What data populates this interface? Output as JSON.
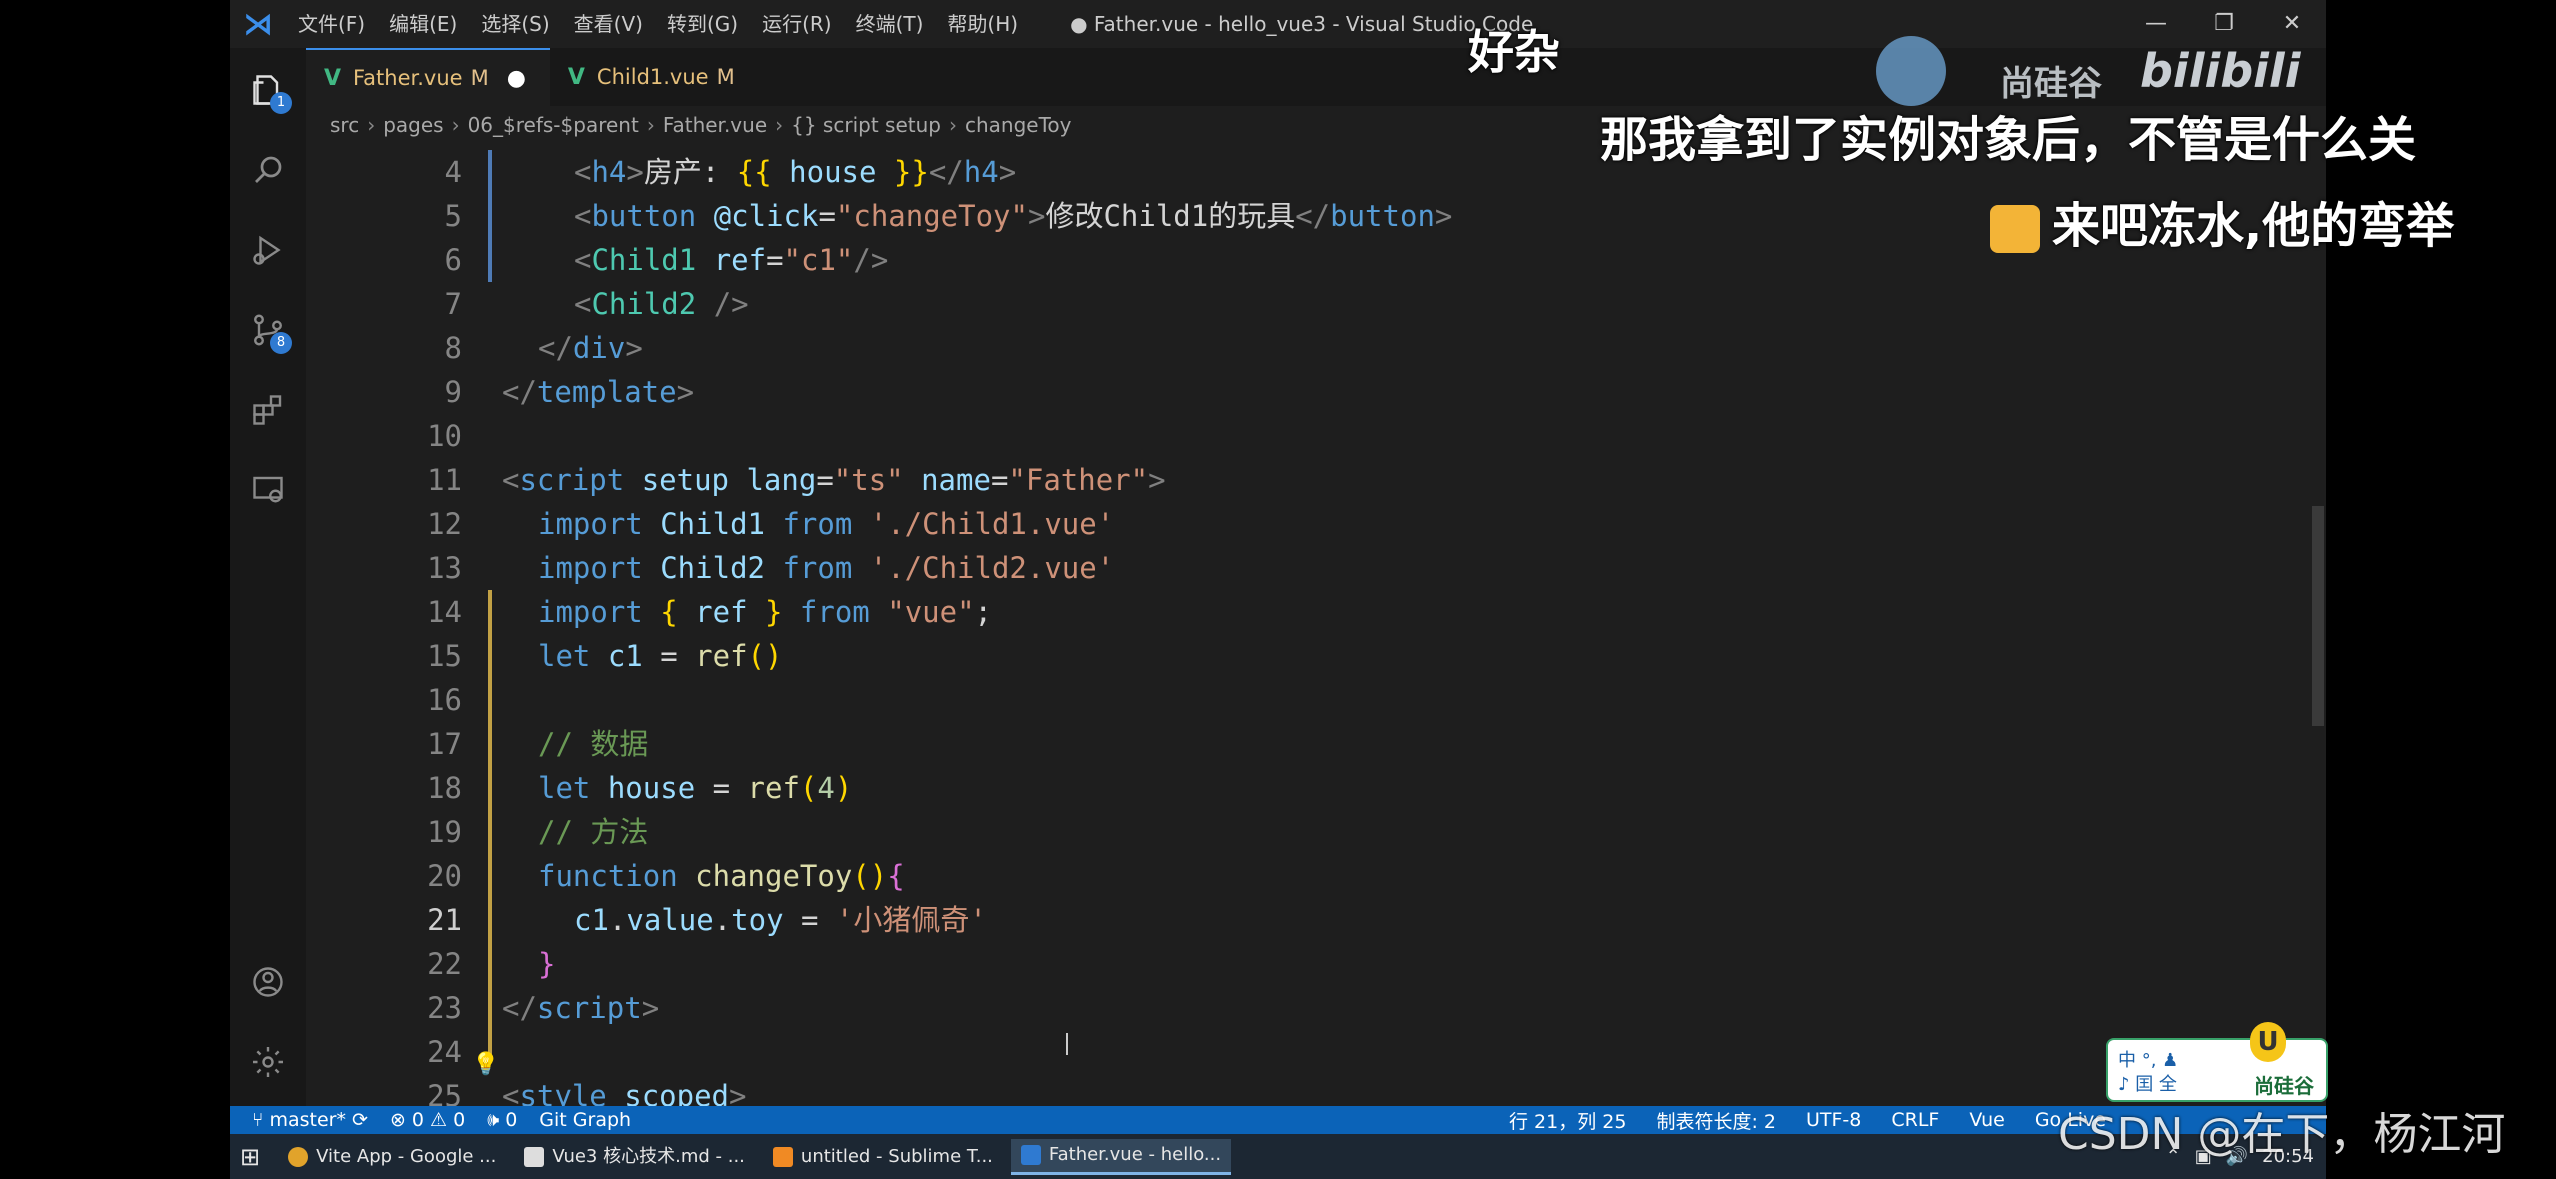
{
  "titlebar": {
    "menus": [
      "文件(F)",
      "编辑(E)",
      "选择(S)",
      "查看(V)",
      "转到(G)",
      "运行(R)",
      "终端(T)",
      "帮助(H)"
    ],
    "title": "● Father.vue - hello_vue3 - Visual Studio Code"
  },
  "activity_badges": {
    "explorer": "1",
    "source_control": "8"
  },
  "tabs": [
    {
      "name": "Father.vue",
      "status": "M",
      "dirty": "●"
    },
    {
      "name": "Child1.vue",
      "status": "M"
    }
  ],
  "breadcrumb": [
    "src",
    "pages",
    "06_$refs-$parent",
    "Father.vue",
    "{} script setup",
    "changeToy"
  ],
  "current_line": 21,
  "lines": [
    {
      "n": "4",
      "tokens": [
        [
          "punc",
          "<"
        ],
        [
          "tag",
          "h4"
        ],
        [
          "punc",
          ">"
        ],
        [
          "plain",
          "房产: "
        ],
        [
          "br",
          "{{"
        ],
        [
          "var",
          " house "
        ],
        [
          "br",
          "}}"
        ],
        [
          "punc",
          "</"
        ],
        [
          "tag",
          "h4"
        ],
        [
          "punc",
          ">"
        ]
      ],
      "indent": 2
    },
    {
      "n": "5",
      "tokens": [
        [
          "punc",
          "<"
        ],
        [
          "tag",
          "button"
        ],
        [
          "attr",
          " @click"
        ],
        [
          "plain",
          "="
        ],
        [
          "str",
          "\"changeToy\""
        ],
        [
          "punc",
          ">"
        ],
        [
          "plain",
          "修改Child1的玩具"
        ],
        [
          "punc",
          "</"
        ],
        [
          "tag",
          "button"
        ],
        [
          "punc",
          ">"
        ]
      ],
      "indent": 2
    },
    {
      "n": "6",
      "tokens": [
        [
          "punc",
          "<"
        ],
        [
          "cls",
          "Child1"
        ],
        [
          "attr",
          " ref"
        ],
        [
          "plain",
          "="
        ],
        [
          "str",
          "\"c1\""
        ],
        [
          "punc",
          "/>"
        ]
      ],
      "indent": 2
    },
    {
      "n": "7",
      "tokens": [
        [
          "punc",
          "<"
        ],
        [
          "cls",
          "Child2"
        ],
        [
          "punc",
          " />"
        ]
      ],
      "indent": 2
    },
    {
      "n": "8",
      "tokens": [
        [
          "punc",
          "</"
        ],
        [
          "tag",
          "div"
        ],
        [
          "punc",
          ">"
        ]
      ],
      "indent": 1
    },
    {
      "n": "9",
      "tokens": [
        [
          "punc",
          "</"
        ],
        [
          "tag",
          "template"
        ],
        [
          "punc",
          ">"
        ]
      ],
      "indent": 0
    },
    {
      "n": "10",
      "tokens": [],
      "indent": 0
    },
    {
      "n": "11",
      "tokens": [
        [
          "punc",
          "<"
        ],
        [
          "tag",
          "script"
        ],
        [
          "attr",
          " setup"
        ],
        [
          "attr",
          " lang"
        ],
        [
          "plain",
          "="
        ],
        [
          "str",
          "\"ts\""
        ],
        [
          "attr",
          " name"
        ],
        [
          "plain",
          "="
        ],
        [
          "str",
          "\"Father\""
        ],
        [
          "punc",
          ">"
        ]
      ],
      "indent": 0
    },
    {
      "n": "12",
      "tokens": [
        [
          "kw",
          "import"
        ],
        [
          "var",
          " Child1 "
        ],
        [
          "kw",
          "from"
        ],
        [
          "str",
          " './Child1.vue'"
        ]
      ],
      "indent": 1
    },
    {
      "n": "13",
      "tokens": [
        [
          "kw",
          "import"
        ],
        [
          "var",
          " Child2 "
        ],
        [
          "kw",
          "from"
        ],
        [
          "str",
          " './Child2.vue'"
        ]
      ],
      "indent": 1
    },
    {
      "n": "14",
      "tokens": [
        [
          "kw",
          "import"
        ],
        [
          "br",
          " {"
        ],
        [
          "var",
          " ref "
        ],
        [
          "br",
          "}"
        ],
        [
          "kw",
          " from"
        ],
        [
          "str",
          " \"vue\""
        ],
        [
          "plain",
          ";"
        ]
      ],
      "indent": 1
    },
    {
      "n": "15",
      "tokens": [
        [
          "kw",
          "let"
        ],
        [
          "var",
          " c1 "
        ],
        [
          "plain",
          "= "
        ],
        [
          "fn",
          "ref"
        ],
        [
          "br",
          "()"
        ]
      ],
      "indent": 1
    },
    {
      "n": "16",
      "tokens": [],
      "indent": 0
    },
    {
      "n": "17",
      "tokens": [
        [
          "cm",
          "// 数据"
        ]
      ],
      "indent": 1
    },
    {
      "n": "18",
      "tokens": [
        [
          "kw",
          "let"
        ],
        [
          "var",
          " house "
        ],
        [
          "plain",
          "= "
        ],
        [
          "fn",
          "ref"
        ],
        [
          "br",
          "("
        ],
        [
          "num",
          "4"
        ],
        [
          "br",
          ")"
        ]
      ],
      "indent": 1
    },
    {
      "n": "19",
      "tokens": [
        [
          "cm",
          "// 方法"
        ]
      ],
      "indent": 1
    },
    {
      "n": "20",
      "tokens": [
        [
          "kw",
          "function"
        ],
        [
          "fn",
          " changeToy"
        ],
        [
          "br",
          "()"
        ],
        [
          "br2",
          "{"
        ]
      ],
      "indent": 1
    },
    {
      "n": "21",
      "tokens": [
        [
          "var",
          "c1"
        ],
        [
          "plain",
          "."
        ],
        [
          "var",
          "value"
        ],
        [
          "plain",
          "."
        ],
        [
          "var",
          "toy"
        ],
        [
          "plain",
          " = "
        ],
        [
          "str",
          "'小猪佩奇'"
        ]
      ],
      "indent": 2
    },
    {
      "n": "22",
      "tokens": [
        [
          "br2",
          "}"
        ]
      ],
      "indent": 1
    },
    {
      "n": "23",
      "tokens": [
        [
          "punc",
          "</"
        ],
        [
          "tag",
          "script"
        ],
        [
          "punc",
          ">"
        ]
      ],
      "indent": 0
    },
    {
      "n": "24",
      "tokens": [],
      "indent": 0
    },
    {
      "n": "25",
      "tokens": [
        [
          "punc",
          "<"
        ],
        [
          "tag",
          "style"
        ],
        [
          "attr",
          " scoped"
        ],
        [
          "punc",
          ">"
        ]
      ],
      "indent": 0
    }
  ],
  "statusbar": {
    "branch": "master*",
    "problems": "⊗ 0 ⚠ 0",
    "ports": "🕪 0",
    "gitgraph": "Git Graph",
    "position": "行 21，列 25",
    "indent": "制表符长度: 2",
    "encoding": "UTF-8",
    "eol": "CRLF",
    "lang": "Vue",
    "golive": "Go Live"
  },
  "taskbar": {
    "items": [
      "Vite App - Google ...",
      "Vue3 核心技术.md - ...",
      "untitled - Sublime T...",
      "Father.vue - hello..."
    ],
    "clock": "20:54"
  },
  "overlay": {
    "danmaku_top": "好杂",
    "danmaku_1": "那我拿到了实例对象后，不管是什么关",
    "danmaku_2": "来吧冻水,他的弯举",
    "brand": "尚硅谷",
    "bili": "bilibili",
    "csdn": "CSDN @在下，杨江河",
    "badge_l1": "中 °, ♟",
    "badge_l2": "♪ 囯 全",
    "badge_text": "尚硅谷",
    "badge_u": "U"
  }
}
